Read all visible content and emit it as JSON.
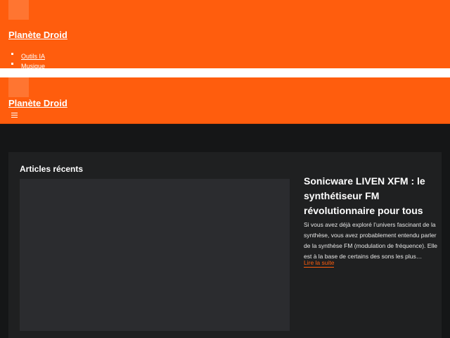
{
  "site": {
    "title": "Planète Droid"
  },
  "nav": {
    "items": [
      {
        "label": "Outils IA"
      },
      {
        "label": "Musique"
      }
    ]
  },
  "icons": {
    "menu": "hamburger-menu-icon"
  },
  "colors": {
    "brand": "#ff5d0d",
    "background": "#151617",
    "panel": "#1f2021",
    "thumbnail": "#2b2c2f"
  },
  "recent": {
    "heading": "Articles récents",
    "article": {
      "title": "Sonicware LIVEN XFM : le synthétiseur FM révolutionnaire pour tous",
      "excerpt": "Si vous avez déjà exploré l’univers fascinant de la synthèse, vous avez probablement entendu parler de la synthèse FM (modulation de fréquence). Elle est à la base de certains des sons les plus…",
      "read_more": "Lire la suite"
    }
  }
}
